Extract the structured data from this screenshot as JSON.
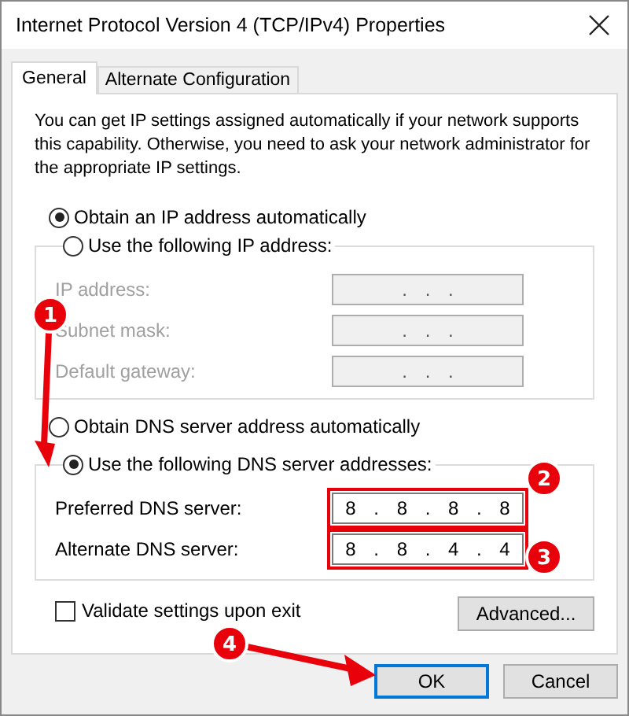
{
  "window": {
    "title": "Internet Protocol Version 4 (TCP/IPv4) Properties"
  },
  "tabs": [
    {
      "label": "General",
      "selected": true
    },
    {
      "label": "Alternate Configuration",
      "selected": false
    }
  ],
  "description": "You can get IP settings assigned automatically if your network supports this capability. Otherwise, you need to ask your network administrator for the appropriate IP settings.",
  "ip_options": [
    {
      "label": "Obtain an IP address automatically",
      "selected": true
    },
    {
      "label": "Use the following IP address:",
      "selected": false
    }
  ],
  "ip_fields": [
    {
      "label": "IP address:",
      "value": ". . .",
      "disabled": true
    },
    {
      "label": "Subnet mask:",
      "value": ". . .",
      "disabled": true
    },
    {
      "label": "Default gateway:",
      "value": ". . .",
      "disabled": true
    }
  ],
  "dns_options": [
    {
      "label": "Obtain DNS server address automatically",
      "selected": false
    },
    {
      "label": "Use the following DNS server addresses:",
      "selected": true
    }
  ],
  "dns_fields": [
    {
      "label": "Preferred DNS server:",
      "value": "8 . 8 . 8 . 8",
      "disabled": false,
      "highlighted": true
    },
    {
      "label": "Alternate DNS server:",
      "value": "8 . 8 . 4 . 4",
      "disabled": false,
      "highlighted": true
    }
  ],
  "validate": {
    "label": "Validate settings upon exit",
    "checked": false
  },
  "advanced_button": "Advanced...",
  "buttons": [
    {
      "label": "OK",
      "default": true
    },
    {
      "label": "Cancel",
      "default": false
    }
  ],
  "annotations": [
    {
      "label": "1",
      "kind": "arrow"
    },
    {
      "label": "2",
      "kind": "badge"
    },
    {
      "label": "3",
      "kind": "badge"
    },
    {
      "label": "4",
      "kind": "arrow"
    }
  ]
}
